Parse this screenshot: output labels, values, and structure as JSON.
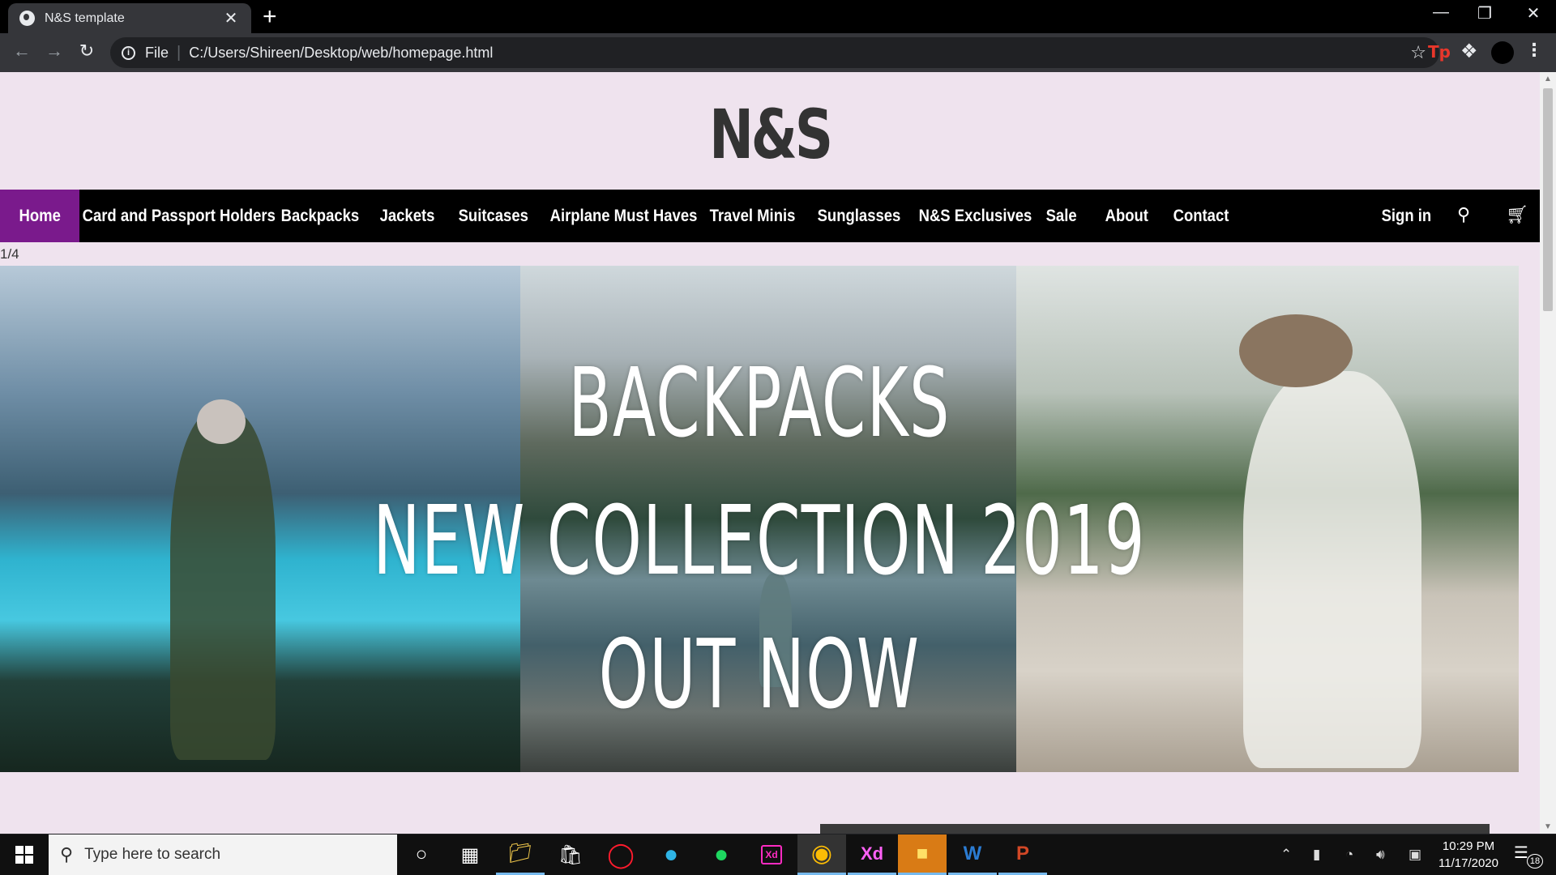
{
  "browser": {
    "tab_title": "N&S template",
    "tab_close": "✕",
    "new_tab": "+",
    "url_scheme": "File",
    "url_separator": "|",
    "url": "C:/Users/Shireen/Desktop/web/homepage.html",
    "extensions": {
      "tp_label": "Tp"
    },
    "icons": [
      "back-icon",
      "forward-icon",
      "reload-icon",
      "info-icon",
      "star-icon",
      "puzzle-icon",
      "more-icon"
    ]
  },
  "site": {
    "logo": "N&S",
    "nav": {
      "items": [
        {
          "label": "Home",
          "active": true
        },
        {
          "label": "Card and Passport Holders"
        },
        {
          "label": "Backpacks"
        },
        {
          "label": "Jackets"
        },
        {
          "label": "Suitcases"
        },
        {
          "label": "Airplane Must Haves"
        },
        {
          "label": "Travel Minis"
        },
        {
          "label": "Sunglasses"
        },
        {
          "label": "N&S Exclusives"
        },
        {
          "label": "Sale"
        },
        {
          "label": "About"
        },
        {
          "label": "Contact"
        }
      ],
      "sign_in": "Sign in",
      "active_color": "#7a1a8c"
    },
    "slideshow": {
      "counter": "1/4",
      "lines": [
        "BACKPACKS",
        "NEW COLLECTION 2019",
        "OUT NOW"
      ]
    }
  },
  "taskbar": {
    "search_placeholder": "Type here to search",
    "apps": [
      "cortana-icon",
      "task-view-icon",
      "file-explorer-icon",
      "store-icon",
      "opera-icon",
      "edge-icon",
      "spotify-icon",
      "xd-icon",
      "chrome-icon",
      "xd-icon",
      "sticky-notes-icon",
      "word-icon",
      "powerpoint-icon"
    ],
    "xd_label": "Xd",
    "word_label": "W",
    "ppt_label": "P",
    "time": "10:29 PM",
    "date": "11/17/2020",
    "notification_count": "18"
  }
}
